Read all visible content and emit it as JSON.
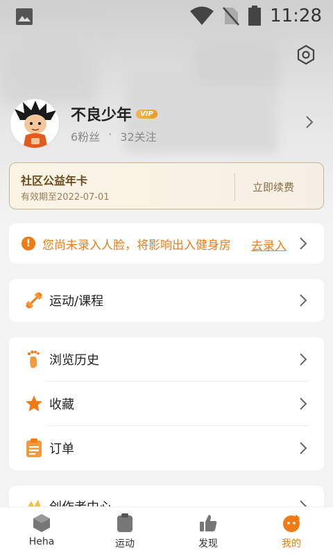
{
  "status_bar": {
    "time": "11:28"
  },
  "profile": {
    "name": "不良少年",
    "vip_badge": "VIP",
    "followers": "6粉丝",
    "separator": "·",
    "following": "32关注"
  },
  "annual_card": {
    "title": "社区公益年卡",
    "expiry": "有效期至2022-07-01",
    "renew_label": "立即续费"
  },
  "face_warning": {
    "icon": "!",
    "text": "您尚未录入人脸，将影响出入健身房",
    "link": "去录入"
  },
  "sport_row": {
    "label": "运动/课程"
  },
  "list": [
    {
      "label": "浏览历史",
      "icon": "footprint-icon"
    },
    {
      "label": "收藏",
      "icon": "star-icon"
    },
    {
      "label": "订单",
      "icon": "clipboard-icon"
    }
  ],
  "creator_row": {
    "label": "创作者中心"
  },
  "tabs": [
    {
      "label": "Heha",
      "icon": "heha-icon"
    },
    {
      "label": "运动",
      "icon": "sport-icon"
    },
    {
      "label": "发现",
      "icon": "thumb-icon"
    },
    {
      "label": "我的",
      "icon": "mine-icon"
    }
  ],
  "colors": {
    "accent": "#f07a13",
    "gold": "#6b4a1c"
  }
}
